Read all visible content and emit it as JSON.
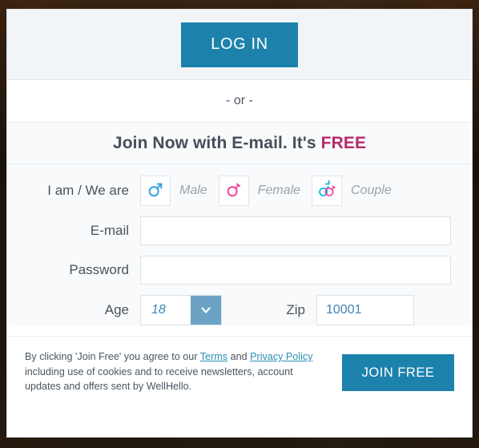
{
  "login": {
    "button_label": "LOG IN"
  },
  "divider": {
    "text": "- or -"
  },
  "heading": {
    "prefix": "Join Now with E-mail. It's ",
    "highlight": "FREE",
    "highlight_color": "#b52b6a"
  },
  "form": {
    "gender": {
      "label": "I am / We are",
      "options": [
        {
          "value": "male",
          "label": "Male",
          "icon": "mars-symbol-icon",
          "color": "#2f9fe0"
        },
        {
          "value": "female",
          "label": "Female",
          "icon": "venus-symbol-icon",
          "color": "#f0409a"
        },
        {
          "value": "couple",
          "label": "Couple",
          "icon": "couple-symbols-icon",
          "color": "#00b5e2"
        }
      ]
    },
    "email": {
      "label": "E-mail",
      "value": "",
      "placeholder": ""
    },
    "password": {
      "label": "Password",
      "value": "",
      "placeholder": ""
    },
    "age": {
      "label": "Age",
      "value": "18",
      "dropdown_icon": "chevron-down-icon"
    },
    "zip": {
      "label": "Zip",
      "value": "10001",
      "placeholder": ""
    }
  },
  "footer": {
    "disclaimer_part1": "By clicking 'Join Free' you agree to our ",
    "terms_link": "Terms",
    "disclaimer_part2": " and ",
    "privacy_link": "Privacy Policy",
    "disclaimer_part3": " including use of cookies and to receive newsletters, account updates and offers sent by WellHello.",
    "join_button_label": "JOIN FREE"
  },
  "theme": {
    "accent": "#1c82ab",
    "link": "#2a8fb5",
    "field_text": "#3f85b5"
  }
}
